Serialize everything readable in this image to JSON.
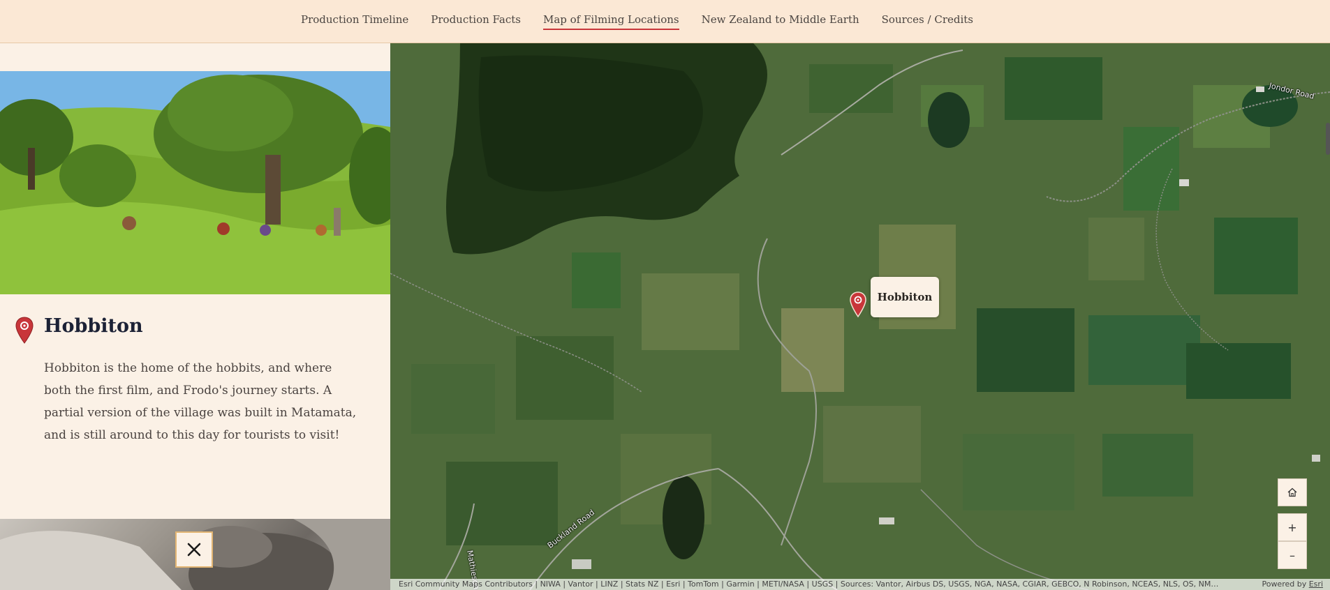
{
  "nav": {
    "items": [
      {
        "label": "Production Timeline",
        "active": false
      },
      {
        "label": "Production Facts",
        "active": false
      },
      {
        "label": "Map of Filming Locations",
        "active": true
      },
      {
        "label": "New Zealand to Middle Earth",
        "active": false
      },
      {
        "label": "Sources / Credits",
        "active": false
      }
    ]
  },
  "location": {
    "title": "Hobbiton",
    "description": "Hobbiton is the home of the hobbits, and where both the first film, and Frodo's journey starts. A partial version of the village was built in Matamata, and is still around to this day for tourists to visit!",
    "icon": "map-pin-icon"
  },
  "map": {
    "popup_label": "Hobbiton",
    "road_labels": [
      "Jondor Road",
      "Buckland Road",
      "Mathieson Ro"
    ],
    "controls": {
      "home_icon": "home-icon",
      "zoom_in": "+",
      "zoom_out": "–"
    },
    "attribution": "Esri Community Maps Contributors | NIWA | Vantor | LINZ | Stats NZ | Esri | TomTom | Garmin | METI/NASA | USGS | Sources: Vantor, Airbus DS, USGS, NGA, NASA, CGIAR, GEBCO, N Robinson, NCEAS, NLS, OS, NMA, Geo...",
    "powered_by_prefix": "Powered by ",
    "powered_by_link": "Esri"
  },
  "close": {
    "icon": "close-icon"
  },
  "colors": {
    "accent": "#c8363a",
    "panel_bg": "#fbf1e6",
    "nav_bg": "#fbe8d5",
    "title": "#1c2236",
    "button_border": "#e2b573"
  }
}
